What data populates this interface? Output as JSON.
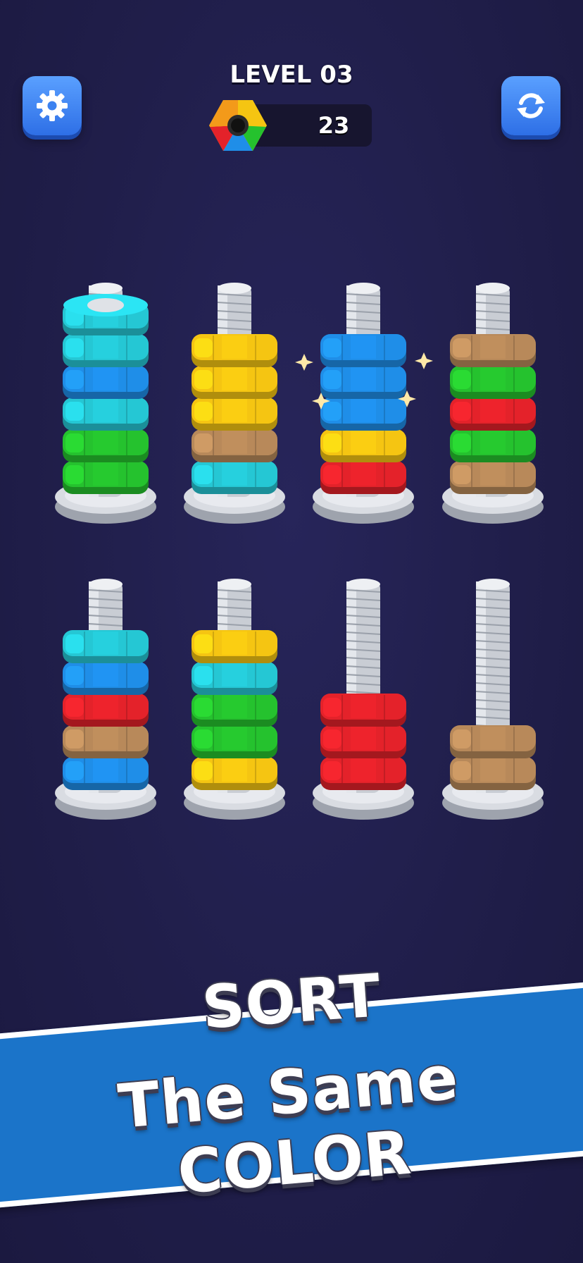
{
  "header": {
    "level_label": "LEVEL 03",
    "counter_value": "23"
  },
  "icons": {
    "settings": "gear-icon",
    "restart": "refresh-icon",
    "counter": "rainbow-hex-nut-icon"
  },
  "colors": {
    "cyan": "#25c7d4",
    "blue": "#1f8ee8",
    "green": "#25c22e",
    "yellow": "#f5c512",
    "tan": "#b8895a",
    "red": "#e4222a"
  },
  "board": {
    "rows": [
      [
        {
          "nuts": [
            "green",
            "green",
            "cyan",
            "blue",
            "cyan",
            "cyan"
          ],
          "bolt_covered": true
        },
        {
          "nuts": [
            "cyan",
            "tan",
            "yellow",
            "yellow",
            "yellow"
          ]
        },
        {
          "nuts": [
            "red",
            "yellow",
            "blue",
            "blue",
            "blue"
          ],
          "sparkle": true
        },
        {
          "nuts": [
            "tan",
            "green",
            "red",
            "green",
            "tan"
          ]
        }
      ],
      [
        {
          "nuts": [
            "blue",
            "tan",
            "red",
            "blue",
            "cyan"
          ]
        },
        {
          "nuts": [
            "yellow",
            "green",
            "green",
            "cyan",
            "yellow"
          ]
        },
        {
          "nuts": [
            "red",
            "red",
            "red"
          ]
        },
        {
          "nuts": [
            "tan",
            "tan"
          ]
        }
      ]
    ]
  },
  "banner": {
    "line1": "SORT",
    "line2": "The Same COLOR"
  }
}
